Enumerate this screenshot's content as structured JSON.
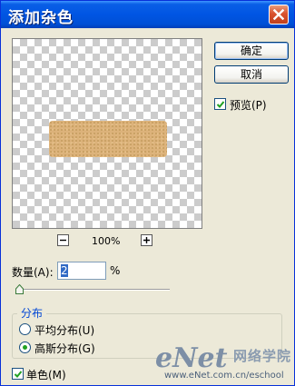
{
  "window": {
    "title": "添加杂色"
  },
  "preview": {
    "zoom": "100%"
  },
  "buttons": {
    "ok": "确定",
    "cancel": "取消"
  },
  "preview_option": {
    "label": "预览(P)",
    "checked": true
  },
  "amount": {
    "label": "数量(A):",
    "value": "2",
    "unit": "%",
    "level": 0.02
  },
  "distribution": {
    "title": "分布",
    "options": [
      {
        "label": "平均分布(U)",
        "selected": false
      },
      {
        "label": "高斯分布(G)",
        "selected": true
      }
    ]
  },
  "monochrome": {
    "label": "单色(M)",
    "checked": true
  },
  "watermark": {
    "logo": "eNet",
    "cn": "网络学院",
    "url": "www.eNet.com.cn/eschool"
  },
  "colors": {
    "titlebar": "#0055e3",
    "swatch": "#dcb27a",
    "radio_dot": "#21a121"
  }
}
